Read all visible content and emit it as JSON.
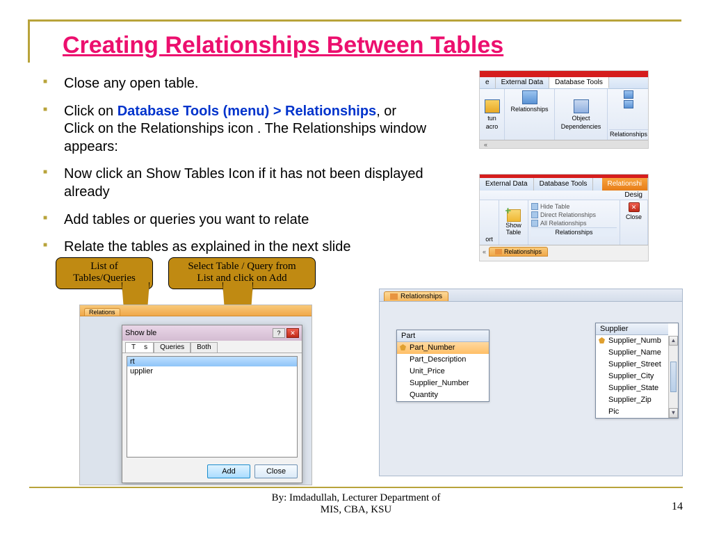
{
  "title": "Creating Relationships Between Tables",
  "bullets": {
    "b1": "Close any open table.",
    "b2a": "Click on ",
    "b2b": "Database Tools (menu) > Relationships",
    "b2c": ", or Click on the Relationships icon . The Relationships window appears:",
    "b3": "Now click an Show Tables Icon if it has not been displayed already",
    "b4": "Add tables  or queries you want to relate",
    "b5": "Relate the tables as explained in the next slide"
  },
  "callouts": {
    "c1a": "List of",
    "c1b": "Tables/Queries",
    "c2a": "Select Table / Query from",
    "c2b": "List and click on Add"
  },
  "ribbon1": {
    "tabs": {
      "t1": "e",
      "t2": "External Data",
      "t3": "Database Tools"
    },
    "btn_run": "tun",
    "btn_run2": "acro",
    "btn_rel": "Relationships",
    "btn_obj1": "Object",
    "btn_obj2": "Dependencies",
    "group": "Relationships",
    "qat": "«"
  },
  "ribbon2": {
    "tabs": {
      "t1": "External Data",
      "t2": "Database Tools",
      "t3": "Relationshi",
      "t4": "Desig"
    },
    "g1_lbl": "ort",
    "g1_btn1": "Show",
    "g1_btn2": "Table",
    "mini1": "Hide Table",
    "mini2": "Direct Relationships",
    "mini3": "All Relationships",
    "grp": "Relationships",
    "close": "Close",
    "crumb": "Relationships"
  },
  "dialog": {
    "win_tab": "Relations",
    "title": "Show    ble",
    "sub1": "T",
    "sub1b": "s",
    "sub2": "Queries",
    "sub3": "Both",
    "row1": "rt",
    "row2": "upplier",
    "add": "Add",
    "close": "Close"
  },
  "relwin": {
    "tab": "Relationships",
    "part_hdr": "Part",
    "part": [
      "Part_Number",
      "Part_Description",
      "Unit_Price",
      "Supplier_Number",
      "Quantity"
    ],
    "supp_hdr": "Supplier",
    "supp": [
      "Supplier_Numb",
      "Supplier_Name",
      "Supplier_Street",
      "Supplier_City",
      "Supplier_State",
      "Supplier_Zip",
      "Pic"
    ]
  },
  "footer": {
    "l1": "By: Imdadullah, Lecturer Department of",
    "l2": "MIS, CBA, KSU",
    "page": "14"
  }
}
